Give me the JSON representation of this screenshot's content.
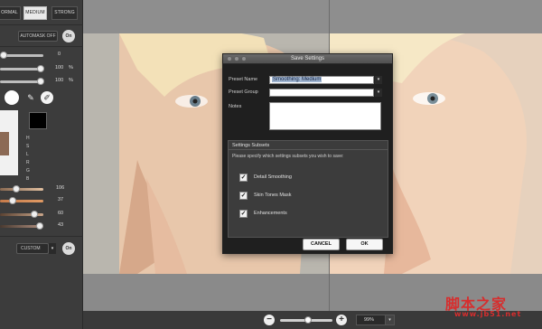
{
  "left_panel": {
    "modes": [
      "ORMAL",
      "MEDIUM",
      "STRONG"
    ],
    "active_mode": "MEDIUM",
    "automask_label": "AUTOMASK OFF",
    "toggle_label": "On",
    "sliders_top": [
      {
        "value": "0",
        "unit": ""
      },
      {
        "value": "100",
        "unit": "%"
      },
      {
        "value": "100",
        "unit": "%"
      }
    ],
    "hsl_letters": [
      "H",
      "S",
      "L",
      "R",
      "G",
      "B"
    ],
    "color_sliders": [
      {
        "value": "106",
        "color": "#c9a07a"
      },
      {
        "value": "37",
        "color": "#b26d3e"
      },
      {
        "value": "60",
        "color": "#7a5a42"
      },
      {
        "value": "43",
        "color": "#6b5040"
      }
    ],
    "custom_label": "CUSTOM",
    "custom_toggle": "On"
  },
  "dialog": {
    "title": "Save Settings",
    "preset_name_label": "Preset Name",
    "preset_name_value": "Smoothing: Medium",
    "preset_group_label": "Preset Group",
    "notes_label": "Notes",
    "subsets_title": "Settings Subsets",
    "subsets_help": "Please specify which settings subsets you wish to save:",
    "subsets": [
      {
        "label": "Detail Smoothing",
        "checked": true
      },
      {
        "label": "Skin Tones Mask",
        "checked": true
      },
      {
        "label": "Enhancements",
        "checked": true
      }
    ],
    "cancel_label": "CANCEL",
    "ok_label": "OK"
  },
  "zoom": {
    "minus": "−",
    "plus": "+",
    "value": "99%"
  },
  "watermark": {
    "text": "脚本之家",
    "url": "www.jb51.net"
  }
}
